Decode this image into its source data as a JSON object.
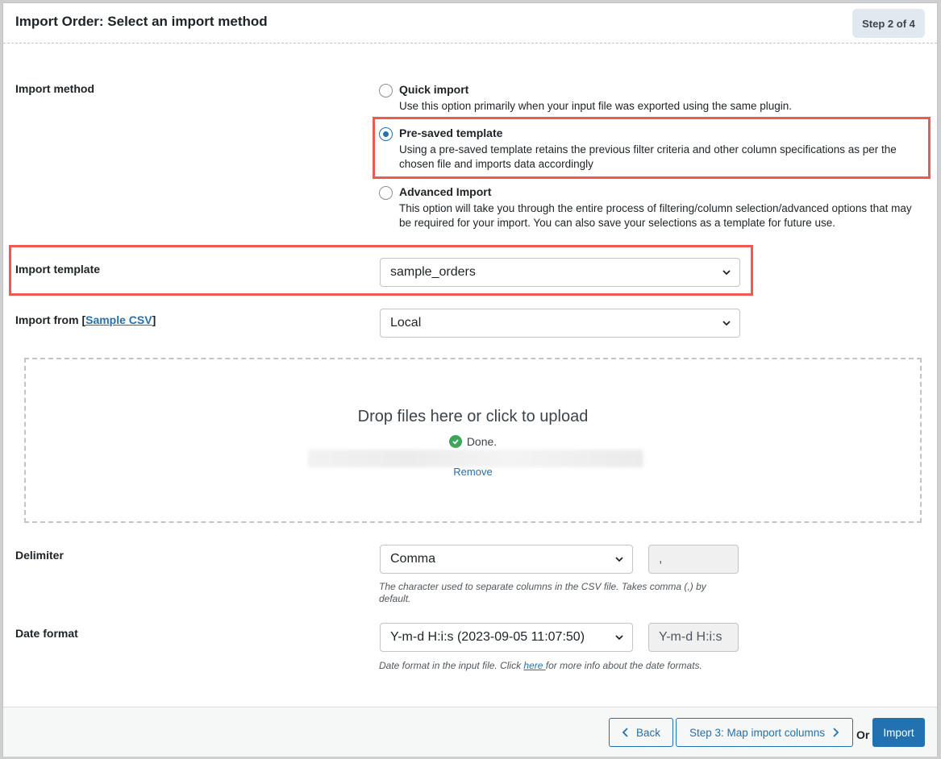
{
  "header": {
    "title": "Import Order: Select an import method",
    "step": "Step 2 of 4"
  },
  "import_method": {
    "label": "Import method",
    "options": [
      {
        "title": "Quick import",
        "description": "Use this option primarily when your input file was exported using the same plugin.",
        "selected": false
      },
      {
        "title": "Pre-saved template",
        "description": "Using a pre-saved template retains the previous filter criteria and other column specifications as per the chosen file and imports data accordingly",
        "selected": true
      },
      {
        "title": "Advanced Import",
        "description": "This option will take you through the entire process of filtering/column selection/advanced options that may be required for your import. You can also save your selections as a template for future use.",
        "selected": false
      }
    ]
  },
  "import_template": {
    "label": "Import template",
    "value": "sample_orders"
  },
  "import_from": {
    "label_prefix": "Import from [",
    "link": "Sample CSV",
    "label_suffix": "]",
    "value": "Local"
  },
  "upload": {
    "title": "Drop files here or click to upload",
    "status": "Done.",
    "remove": "Remove"
  },
  "delimiter": {
    "label": "Delimiter",
    "value": "Comma",
    "char": ",",
    "help": "The character used to separate columns in the CSV file. Takes comma (,) by default."
  },
  "date_format": {
    "label": "Date format",
    "value": "Y-m-d H:i:s (2023-09-05 11:07:50)",
    "format": "Y-m-d H:i:s",
    "help_prefix": "Date format in the input file. Click ",
    "help_link": "here ",
    "help_suffix": "for more info about the date formats."
  },
  "footer": {
    "back": "Back",
    "next": "Step 3: Map import columns",
    "or": "Or",
    "import": "Import"
  },
  "colors": {
    "accent": "#2271b1",
    "highlight": "#ee5a4f",
    "success": "#3ba55c"
  }
}
